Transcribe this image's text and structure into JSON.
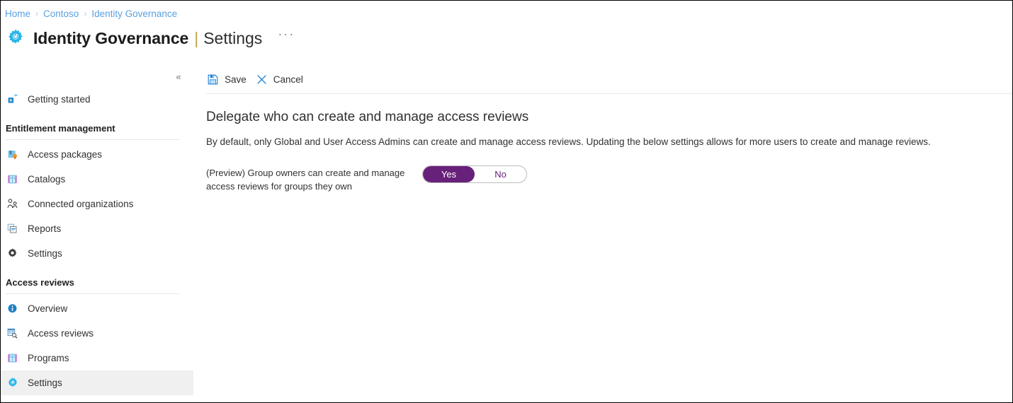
{
  "breadcrumb": {
    "separator": "›",
    "items": [
      {
        "label": "Home"
      },
      {
        "label": "Contoso"
      },
      {
        "label": "Identity Governance"
      }
    ]
  },
  "header": {
    "icon": "identity-governance-gear-icon",
    "title": "Identity Governance",
    "divider": "|",
    "subtitle": "Settings",
    "more_label": "···"
  },
  "sidebar": {
    "collapse_label": "«",
    "top_items": [
      {
        "label": "Getting started",
        "icon": "getting-started-icon",
        "selected": false
      }
    ],
    "sections": [
      {
        "title": "Entitlement management",
        "items": [
          {
            "label": "Access packages",
            "icon": "access-packages-icon",
            "selected": false
          },
          {
            "label": "Catalogs",
            "icon": "catalogs-book-icon",
            "selected": false
          },
          {
            "label": "Connected organizations",
            "icon": "connected-organizations-icon",
            "selected": false
          },
          {
            "label": "Reports",
            "icon": "reports-icon",
            "selected": false
          },
          {
            "label": "Settings",
            "icon": "settings-gear-icon",
            "selected": false
          }
        ]
      },
      {
        "title": "Access reviews",
        "items": [
          {
            "label": "Overview",
            "icon": "overview-info-icon",
            "selected": false
          },
          {
            "label": "Access reviews",
            "icon": "access-reviews-search-icon",
            "selected": false
          },
          {
            "label": "Programs",
            "icon": "programs-book-icon",
            "selected": false
          },
          {
            "label": "Settings",
            "icon": "settings-gear-blue-icon",
            "selected": true
          }
        ]
      }
    ]
  },
  "toolbar": {
    "save_label": "Save",
    "save_icon": "save-disk-icon",
    "cancel_label": "Cancel",
    "cancel_icon": "cancel-x-icon"
  },
  "main": {
    "heading": "Delegate who can create and manage access reviews",
    "description": "By default, only Global and User Access Admins can create and manage access reviews. Updating the below settings allows for more users to create and manage reviews.",
    "setting": {
      "label": "(Preview) Group owners can create and manage access reviews for groups they own",
      "toggle": {
        "yes_label": "Yes",
        "no_label": "No",
        "value": "Yes"
      }
    }
  },
  "colors": {
    "accent_blue": "#0078d4",
    "link_blue": "#5aa0e0",
    "toggle_purple": "#68217a",
    "selected_row": "#f0f0f0",
    "title_pipe": "#c3a04b"
  }
}
